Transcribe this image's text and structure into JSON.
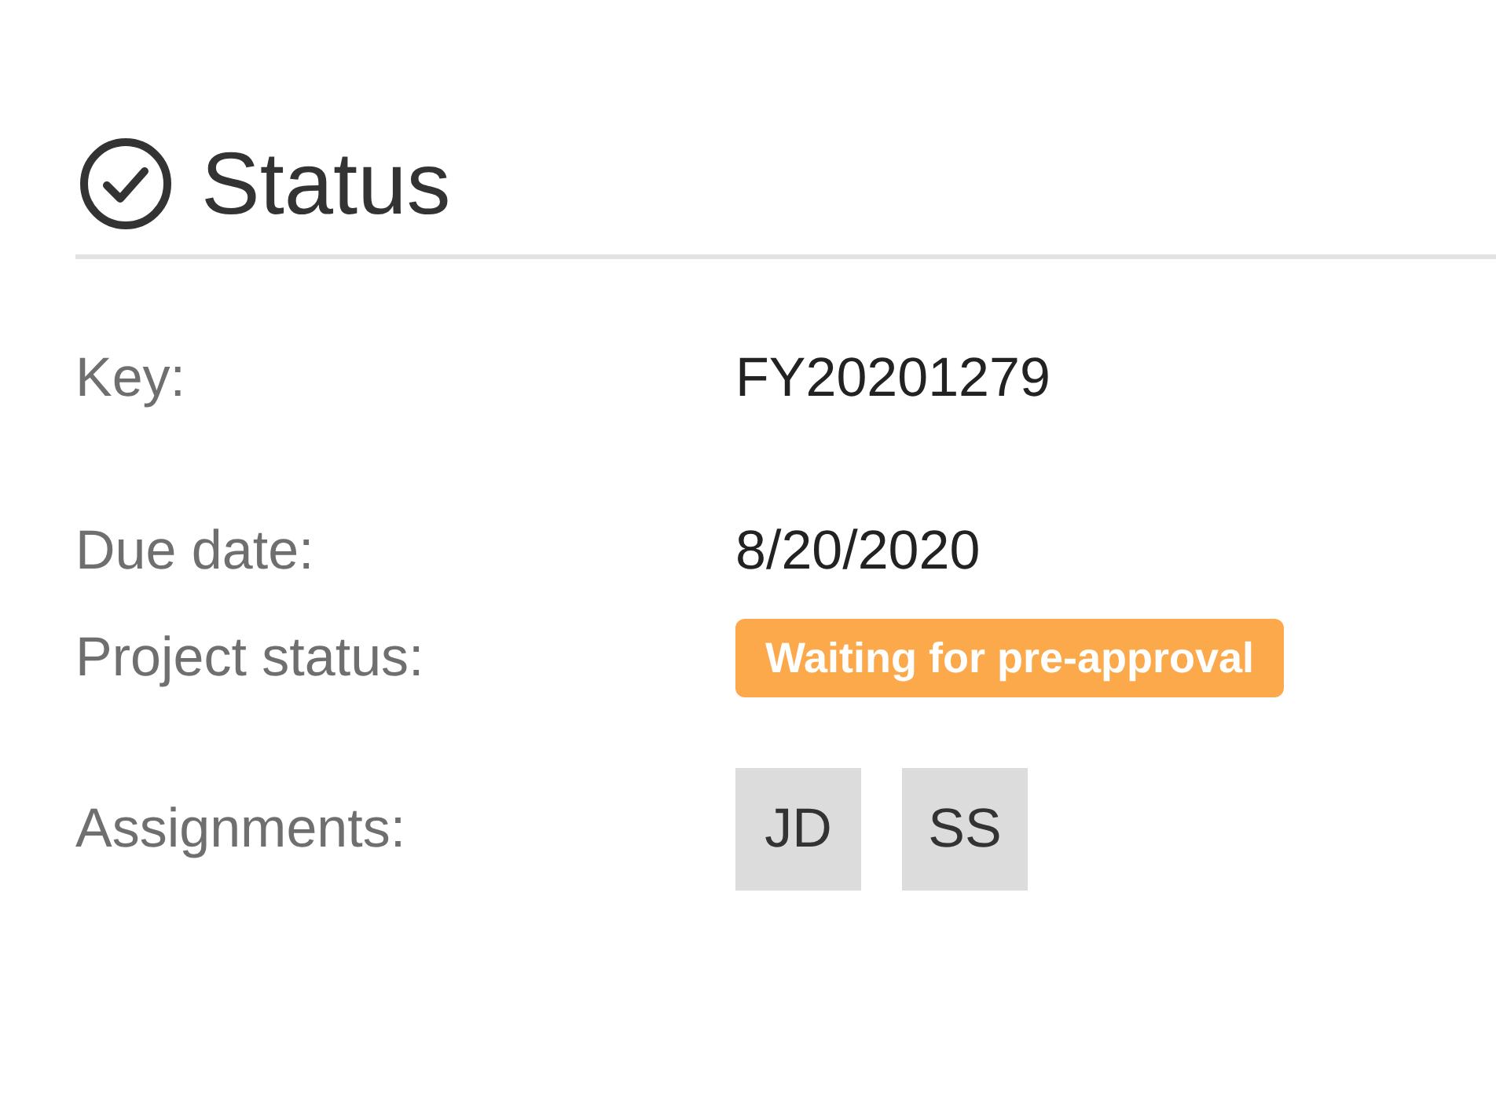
{
  "section": {
    "title": "Status"
  },
  "fields": [
    {
      "kind": "text",
      "label": "Key:",
      "value": "FY20201279"
    },
    {
      "kind": "text",
      "label": "Due date:",
      "value": "8/20/2020"
    },
    {
      "kind": "badge",
      "label": "Project status:",
      "value": "Waiting for pre-approval"
    },
    {
      "kind": "avatars",
      "label": "Assignments:",
      "values": [
        "JD",
        "SS"
      ]
    }
  ]
}
